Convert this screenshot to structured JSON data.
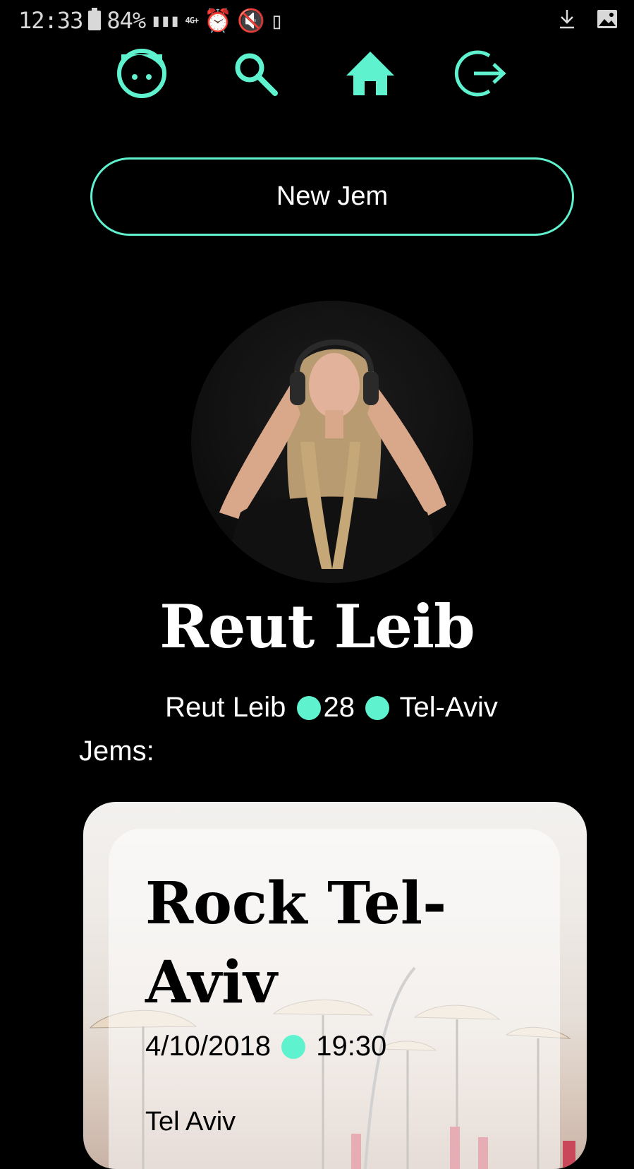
{
  "status_bar": {
    "time": "12:33",
    "battery": "84%",
    "network": "4G+"
  },
  "nav": {
    "items": [
      {
        "icon": "face-icon"
      },
      {
        "icon": "search-icon"
      },
      {
        "icon": "home-icon"
      },
      {
        "icon": "logout-icon"
      }
    ],
    "accent_color": "#5ef2cf"
  },
  "new_jem_button": "New Jem",
  "profile": {
    "name": "Reut Leib",
    "meta_name": "Reut Leib",
    "age": "28",
    "city": "Tel-Aviv"
  },
  "jems_label": "Jems:",
  "events": [
    {
      "title": "Rock Tel-Aviv",
      "date": "4/10/2018",
      "time": "19:30",
      "place": "Tel Aviv"
    }
  ]
}
